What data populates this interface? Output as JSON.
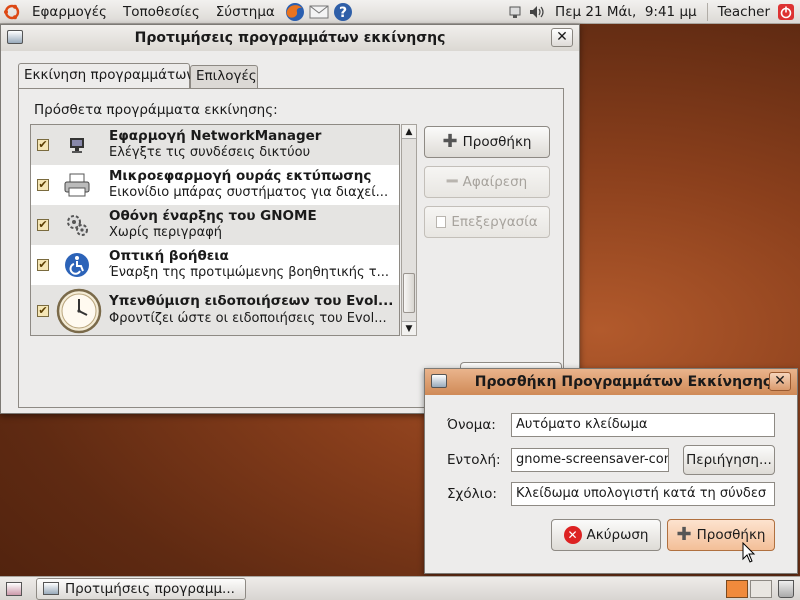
{
  "top_panel": {
    "menus": [
      "Εφαρμογές",
      "Τοποθεσίες",
      "Σύστημα"
    ],
    "clock": "Πεμ 21 Μάι,  9:41 μμ",
    "user": "Teacher"
  },
  "main_window": {
    "title": "Προτιμήσεις προγραμμάτων εκκίνησης",
    "tabs": [
      "Εκκίνηση προγραμμάτων",
      "Επιλογές"
    ],
    "section_label": "Πρόσθετα προγράμματα εκκίνησης:",
    "programs": [
      {
        "title": "Εφαρμογή NetworkManager",
        "desc": "Ελέγξτε τις συνδέσεις δικτύου",
        "icon": "network-monitor-icon"
      },
      {
        "title": "Μικροεφαρμογή ουράς εκτύπωσης",
        "desc": "Εικονίδιο μπάρας συστήματος για διαχεί...",
        "icon": "printer-icon"
      },
      {
        "title": "Οθόνη έναρξης του GNOME",
        "desc": "Χωρίς περιγραφή",
        "icon": "gears-icon"
      },
      {
        "title": "Οπτική βοήθεια",
        "desc": "Έναρξη της προτιμώμενης βοηθητικής τ...",
        "icon": "accessibility-icon"
      },
      {
        "title": "Υπενθύμιση ειδοποιήσεων του Evol...",
        "desc": "Φροντίζει ώστε οι ειδοποιήσεις του Evol...",
        "icon": "clock-icon"
      }
    ],
    "buttons": {
      "add": "Προσθήκη",
      "remove": "Αφαίρεση",
      "edit": "Επεξεργασία"
    }
  },
  "dialog": {
    "title": "Προσθήκη Προγραμμάτων Εκκίνησης",
    "name_label": "Όνομα:",
    "name_value": "Αυτόματο κλείδωμα",
    "command_label": "Εντολή:",
    "command_value": "gnome-screensaver-com",
    "browse_label": "Περιήγηση...",
    "comment_label": "Σχόλιο:",
    "comment_value": "Κλείδωμα υπολογιστή κατά τη σύνδεσ",
    "cancel_label": "Ακύρωση",
    "add_label": "Προσθήκη"
  },
  "taskbar": {
    "window_button": "Προτιμήσεις προγραμμ..."
  },
  "colors": {
    "accent": "#f07746",
    "titlebar_dialog": "#e5a77c",
    "checkbox": "#f5e6b5"
  }
}
